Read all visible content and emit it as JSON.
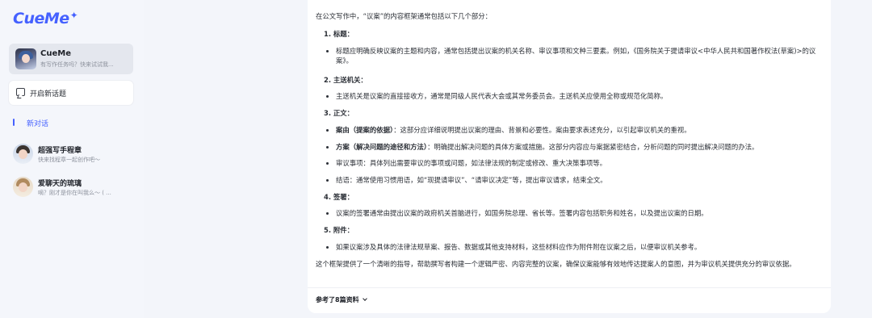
{
  "app": {
    "logo": "CueMe",
    "logo_spark": "✦"
  },
  "sidebar": {
    "agent": {
      "name": "CueMe",
      "subtitle": "有写作任务吗？快来试试我..."
    },
    "new_topic_label": "开启新话题",
    "new_chat_label": "新对话",
    "chats": [
      {
        "title": "超强写手程章",
        "preview": "快来找程章一起创作吧～"
      },
      {
        "title": "爱聊天的琉璃",
        "preview": "嘀？刚才是你在叫我么～ ( ..."
      }
    ]
  },
  "main": {
    "intro": "在公文写作中，“议案”的内容框架通常包括以下几个部分：",
    "sections": [
      {
        "heading": "1. 标题：",
        "bullets": [
          {
            "bold": "",
            "text": "标题应明确反映议案的主题和内容，通常包括提出议案的机关名称、审议事项和文种三要素。例如，《国务院关于提请审议<中华人民共和国著作权法(草案)>的议案》。"
          }
        ]
      },
      {
        "heading": "2. 主送机关：",
        "bullets": [
          {
            "bold": "",
            "text": "主送机关是议案的直接接收方，通常是同级人民代表大会或其常务委员会。主送机关应使用全称或规范化简称。"
          }
        ]
      },
      {
        "heading": "3. 正文：",
        "bullets": [
          {
            "bold": "案由（提案的依据）",
            "text": "：这部分应详细说明提出议案的理由、背景和必要性。案由要求表述充分，以引起审议机关的重视。"
          },
          {
            "bold": "方案（解决问题的途径和方法）",
            "text": "：明确提出解决问题的具体方案或措施。这部分内容应与案据紧密结合，分析问题的同时提出解决问题的办法。"
          },
          {
            "bold": "",
            "text": "审议事项：具体列出需要审议的事项或问题，如法律法规的制定或修改、重大决策事项等。"
          },
          {
            "bold": "",
            "text": "结语：通常使用习惯用语，如“现提请审议”、“请审议决定”等，提出审议请求，结束全文。"
          }
        ]
      },
      {
        "heading": "4. 签署：",
        "bullets": [
          {
            "bold": "",
            "text": "议案的签署通常由提出议案的政府机关首脑进行，如国务院总理、省长等。签署内容包括职务和姓名，以及提出议案的日期。"
          }
        ]
      },
      {
        "heading": "5. 附件：",
        "bullets": [
          {
            "bold": "",
            "text": "如果议案涉及具体的法律法规草案、报告、数据或其他支持材料，这些材料应作为附件附在议案之后，以便审议机关参考。"
          }
        ]
      }
    ],
    "outro": "这个框架提供了一个清晰的指导，帮助撰写者构建一个逻辑严密、内容完整的议案，确保议案能够有效地传达提案人的意图，并为审议机关提供充分的审议依据。",
    "refs_label": "参考了8篇资料"
  },
  "colors": {
    "accent": "#4561ff",
    "sidebar_bg": "#f4f6fb",
    "card_bg": "#e4e7ee"
  }
}
